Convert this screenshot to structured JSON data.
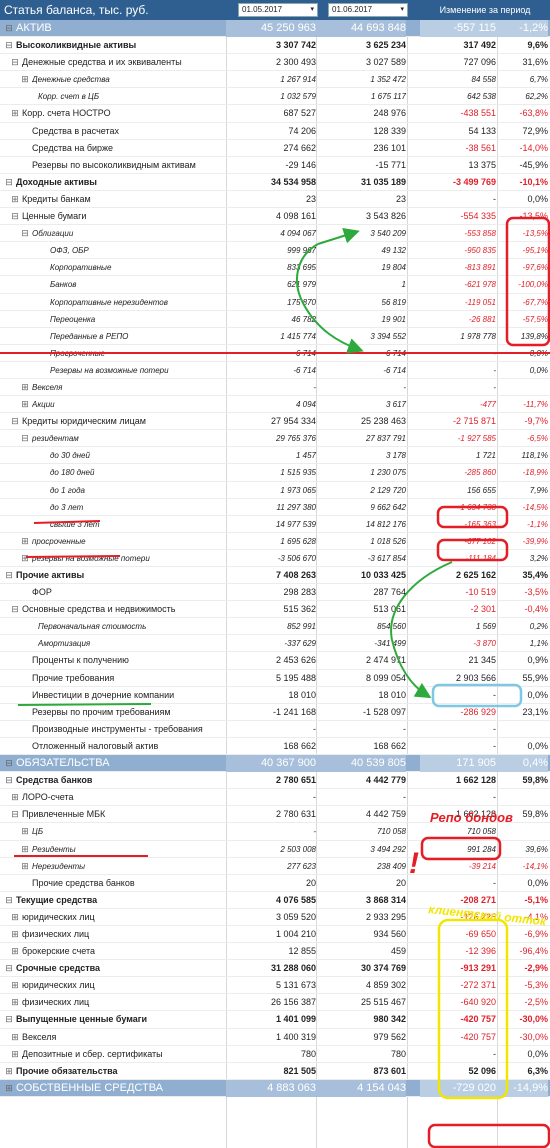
{
  "header": {
    "title": "Статья баланса, тыс. руб.",
    "date1": "01.05.2017",
    "date2": "01.06.2017",
    "dropdown_glyph": "▾",
    "change_label": "Изменение за период"
  },
  "rows": [
    {
      "exp": "⊟",
      "label": "АКТИВ",
      "v1": "45 250 963",
      "v2": "44 693 848",
      "ch": "-557 115",
      "pc": "-1,2%",
      "ind": 4,
      "type": "section",
      "ch_neg": true,
      "pc_neg": true
    },
    {
      "exp": "⊟",
      "label": "Высоколиквидные активы",
      "v1": "3 307 742",
      "v2": "3 625 234",
      "ch": "317 492",
      "pc": "9,6%",
      "ind": 4,
      "type": "lvl0",
      "ch_neg": false,
      "pc_neg": false
    },
    {
      "exp": "⊟",
      "label": "Денежные средства и их эквиваленты",
      "v1": "2 300 493",
      "v2": "3 027 589",
      "ch": "727 096",
      "pc": "31,6%",
      "ind": 10,
      "type": "lvl1",
      "ch_neg": false,
      "pc_neg": false
    },
    {
      "exp": "⊞",
      "label": "Денежные средства",
      "v1": "1 267 914",
      "v2": "1 352 472",
      "ch": "84 558",
      "pc": "6,7%",
      "ind": 20,
      "type": "lvl2",
      "ch_neg": false,
      "pc_neg": false
    },
    {
      "exp": "",
      "label": "Корр. счет в ЦБ",
      "v1": "1 032 579",
      "v2": "1 675 117",
      "ch": "642 538",
      "pc": "62,2%",
      "ind": 26,
      "type": "lvl2",
      "ch_neg": false,
      "pc_neg": false
    },
    {
      "exp": "⊞",
      "label": "Корр. счета НОСТРО",
      "v1": "687 527",
      "v2": "248 976",
      "ch": "-438 551",
      "pc": "-63,8%",
      "ind": 10,
      "type": "lvl1",
      "ch_neg": true,
      "pc_neg": true
    },
    {
      "exp": "",
      "label": "Средства в расчетах",
      "v1": "74 206",
      "v2": "128 339",
      "ch": "54 133",
      "pc": "72,9%",
      "ind": 20,
      "type": "lvl1",
      "ch_neg": false,
      "pc_neg": false
    },
    {
      "exp": "",
      "label": "Средства на бирже",
      "v1": "274 662",
      "v2": "236 101",
      "ch": "-38 561",
      "pc": "-14,0%",
      "ind": 20,
      "type": "lvl1",
      "ch_neg": true,
      "pc_neg": true
    },
    {
      "exp": "",
      "label": "Резервы по высоколиквидным активам",
      "v1": "-29 146",
      "v2": "-15 771",
      "ch": "13 375",
      "pc": "-45,9%",
      "ind": 20,
      "type": "lvl1",
      "ch_neg": false,
      "pc_neg": false
    },
    {
      "exp": "⊟",
      "label": "Доходные активы",
      "v1": "34 534 958",
      "v2": "31 035 189",
      "ch": "-3 499 769",
      "pc": "-10,1%",
      "ind": 4,
      "type": "lvl0",
      "ch_neg": true,
      "pc_neg": true
    },
    {
      "exp": "⊞",
      "label": "Кредиты банкам",
      "v1": "23",
      "v2": "23",
      "ch": "-",
      "pc": "0,0%",
      "ind": 10,
      "type": "lvl1",
      "ch_neg": false,
      "pc_neg": false
    },
    {
      "exp": "⊟",
      "label": "Ценные бумаги",
      "v1": "4 098 161",
      "v2": "3 543 826",
      "ch": "-554 335",
      "pc": "-13,5%",
      "ind": 10,
      "type": "lvl1",
      "ch_neg": true,
      "pc_neg": true
    },
    {
      "exp": "⊟",
      "label": "Облигации",
      "v1": "4 094 067",
      "v2": "3 540 209",
      "ch": "-553 858",
      "pc": "-13,5%",
      "ind": 20,
      "type": "lvl2",
      "ch_neg": true,
      "pc_neg": true
    },
    {
      "exp": "",
      "label": "ОФЗ, ОБР",
      "v1": "999 967",
      "v2": "49 132",
      "ch": "-950 835",
      "pc": "-95,1%",
      "ind": 38,
      "type": "lvl3",
      "ch_neg": true,
      "pc_neg": true
    },
    {
      "exp": "",
      "label": "Корпоративные",
      "v1": "833 695",
      "v2": "19 804",
      "ch": "-813 891",
      "pc": "-97,6%",
      "ind": 38,
      "type": "lvl3",
      "ch_neg": true,
      "pc_neg": true
    },
    {
      "exp": "",
      "label": "Банков",
      "v1": "621 979",
      "v2": "1",
      "ch": "-621 978",
      "pc": "-100,0%",
      "ind": 38,
      "type": "lvl3",
      "ch_neg": true,
      "pc_neg": true
    },
    {
      "exp": "",
      "label": "Корпоративные нерезидентов",
      "v1": "175 870",
      "v2": "56 819",
      "ch": "-119 051",
      "pc": "-67,7%",
      "ind": 38,
      "type": "lvl3",
      "ch_neg": true,
      "pc_neg": true
    },
    {
      "exp": "",
      "label": "Переоценка",
      "v1": "46 782",
      "v2": "19 901",
      "ch": "-26 881",
      "pc": "-57,5%",
      "ind": 38,
      "type": "lvl3",
      "ch_neg": true,
      "pc_neg": true
    },
    {
      "exp": "",
      "label": "Переданные в РЕПО",
      "v1": "1 415 774",
      "v2": "3 394 552",
      "ch": "1 978 778",
      "pc": "139,8%",
      "ind": 38,
      "type": "lvl3",
      "ch_neg": false,
      "pc_neg": false
    },
    {
      "exp": "",
      "label": "Просроченные",
      "v1": "6 714",
      "v2": "6 714",
      "ch": "-",
      "pc": "0,0%",
      "ind": 38,
      "type": "lvl3",
      "ch_neg": false,
      "pc_neg": false
    },
    {
      "exp": "",
      "label": "Резервы на возможные потери",
      "v1": "-6 714",
      "v2": "-6 714",
      "ch": "-",
      "pc": "0,0%",
      "ind": 38,
      "type": "lvl3",
      "ch_neg": false,
      "pc_neg": false
    },
    {
      "exp": "⊞",
      "label": "Векселя",
      "v1": "-",
      "v2": "-",
      "ch": "-",
      "pc": "",
      "ind": 20,
      "type": "lvl2",
      "ch_neg": false,
      "pc_neg": false
    },
    {
      "exp": "⊞",
      "label": "Акции",
      "v1": "4 094",
      "v2": "3 617",
      "ch": "-477",
      "pc": "-11,7%",
      "ind": 20,
      "type": "lvl2",
      "ch_neg": true,
      "pc_neg": true
    },
    {
      "exp": "⊟",
      "label": "Кредиты юридическим лицам",
      "v1": "27 954 334",
      "v2": "25 238 463",
      "ch": "-2 715 871",
      "pc": "-9,7%",
      "ind": 10,
      "type": "lvl1",
      "ch_neg": true,
      "pc_neg": true
    },
    {
      "exp": "⊟",
      "label": "резидентам",
      "v1": "29 765 376",
      "v2": "27 837 791",
      "ch": "-1 927 585",
      "pc": "-6,5%",
      "ind": 20,
      "type": "lvl2",
      "ch_neg": true,
      "pc_neg": true
    },
    {
      "exp": "",
      "label": "до 30 дней",
      "v1": "1 457",
      "v2": "3 178",
      "ch": "1 721",
      "pc": "118,1%",
      "ind": 38,
      "type": "lvl3",
      "ch_neg": false,
      "pc_neg": false
    },
    {
      "exp": "",
      "label": "до 180 дней",
      "v1": "1 515 935",
      "v2": "1 230 075",
      "ch": "-285 860",
      "pc": "-18,9%",
      "ind": 38,
      "type": "lvl3",
      "ch_neg": true,
      "pc_neg": true
    },
    {
      "exp": "",
      "label": "до 1 года",
      "v1": "1 973 065",
      "v2": "2 129 720",
      "ch": "156 655",
      "pc": "7,9%",
      "ind": 38,
      "type": "lvl3",
      "ch_neg": false,
      "pc_neg": false
    },
    {
      "exp": "",
      "label": "до 3 лет",
      "v1": "11 297 380",
      "v2": "9 662 642",
      "ch": "-1 634 738",
      "pc": "-14,5%",
      "ind": 38,
      "type": "lvl3",
      "ch_neg": true,
      "pc_neg": true
    },
    {
      "exp": "",
      "label": "свыше 3 лет",
      "v1": "14 977 539",
      "v2": "14 812 176",
      "ch": "-165 363",
      "pc": "-1,1%",
      "ind": 38,
      "type": "lvl3",
      "ch_neg": true,
      "pc_neg": true
    },
    {
      "exp": "⊞",
      "label": "просроченные",
      "v1": "1 695 628",
      "v2": "1 018 526",
      "ch": "-677 102",
      "pc": "-39,9%",
      "ind": 20,
      "type": "lvl2",
      "ch_neg": true,
      "pc_neg": true
    },
    {
      "exp": "⊞",
      "label": "резервы на возможные потери",
      "v1": "-3 506 670",
      "v2": "-3 617 854",
      "ch": "-111 184",
      "pc": "3,2%",
      "ind": 20,
      "type": "lvl2",
      "ch_neg": true,
      "pc_neg": false
    },
    {
      "exp": "⊟",
      "label": "Прочие активы",
      "v1": "7 408 263",
      "v2": "10 033 425",
      "ch": "2 625 162",
      "pc": "35,4%",
      "ind": 4,
      "type": "lvl0",
      "ch_neg": false,
      "pc_neg": false
    },
    {
      "exp": "",
      "label": "ФОР",
      "v1": "298 283",
      "v2": "287 764",
      "ch": "-10 519",
      "pc": "-3,5%",
      "ind": 20,
      "type": "lvl1",
      "ch_neg": true,
      "pc_neg": true
    },
    {
      "exp": "⊟",
      "label": "Основные средства и недвижимость",
      "v1": "515 362",
      "v2": "513 061",
      "ch": "-2 301",
      "pc": "-0,4%",
      "ind": 10,
      "type": "lvl1",
      "ch_neg": true,
      "pc_neg": true
    },
    {
      "exp": "",
      "label": "Первоначальная стоимость",
      "v1": "852 991",
      "v2": "854 560",
      "ch": "1 569",
      "pc": "0,2%",
      "ind": 26,
      "type": "lvl2",
      "ch_neg": false,
      "pc_neg": false
    },
    {
      "exp": "",
      "label": "Амортизация",
      "v1": "-337 629",
      "v2": "-341 499",
      "ch": "-3 870",
      "pc": "1,1%",
      "ind": 26,
      "type": "lvl2",
      "ch_neg": true,
      "pc_neg": false
    },
    {
      "exp": "",
      "label": "Проценты к получению",
      "v1": "2 453 626",
      "v2": "2 474 971",
      "ch": "21 345",
      "pc": "0,9%",
      "ind": 20,
      "type": "lvl1",
      "ch_neg": false,
      "pc_neg": false
    },
    {
      "exp": "",
      "label": "Прочие требования",
      "v1": "5 195 488",
      "v2": "8 099 054",
      "ch": "2 903 566",
      "pc": "55,9%",
      "ind": 20,
      "type": "lvl1",
      "ch_neg": false,
      "pc_neg": false
    },
    {
      "exp": "",
      "label": "Инвестиции в дочерние компании",
      "v1": "18 010",
      "v2": "18 010",
      "ch": "-",
      "pc": "0,0%",
      "ind": 20,
      "type": "lvl1",
      "ch_neg": false,
      "pc_neg": false
    },
    {
      "exp": "",
      "label": "Резервы по прочим требованиям",
      "v1": "-1 241 168",
      "v2": "-1 528 097",
      "ch": "-286 929",
      "pc": "23,1%",
      "ind": 20,
      "type": "lvl1",
      "ch_neg": true,
      "pc_neg": false
    },
    {
      "exp": "",
      "label": "Производные инструменты - требования",
      "v1": "-",
      "v2": "-",
      "ch": "-",
      "pc": "",
      "ind": 20,
      "type": "lvl1",
      "ch_neg": false,
      "pc_neg": false
    },
    {
      "exp": "",
      "label": "Отложенный налоговый актив",
      "v1": "168 662",
      "v2": "168 662",
      "ch": "-",
      "pc": "0,0%",
      "ind": 20,
      "type": "lvl1",
      "ch_neg": false,
      "pc_neg": false
    },
    {
      "exp": "⊟",
      "label": "ОБЯЗАТЕЛЬСТВА",
      "v1": "40 367 900",
      "v2": "40 539 805",
      "ch": "171 905",
      "pc": "0,4%",
      "ind": 4,
      "type": "section",
      "ch_neg": false,
      "pc_neg": false
    },
    {
      "exp": "⊟",
      "label": "Средства банков",
      "v1": "2 780 651",
      "v2": "4 442 779",
      "ch": "1 662 128",
      "pc": "59,8%",
      "ind": 4,
      "type": "lvl0",
      "ch_neg": false,
      "pc_neg": false
    },
    {
      "exp": "⊞",
      "label": "ЛОРО-счета",
      "v1": "-",
      "v2": "-",
      "ch": "-",
      "pc": "",
      "ind": 10,
      "type": "lvl1",
      "ch_neg": false,
      "pc_neg": false
    },
    {
      "exp": "⊟",
      "label": "Привлеченные МБК",
      "v1": "2 780 631",
      "v2": "4 442 759",
      "ch": "1 662 128",
      "pc": "59,8%",
      "ind": 10,
      "type": "lvl1",
      "ch_neg": false,
      "pc_neg": false
    },
    {
      "exp": "⊞",
      "label": "ЦБ",
      "v1": "-",
      "v2": "710 058",
      "ch": "710 058",
      "pc": "",
      "ind": 20,
      "type": "lvl2",
      "ch_neg": false,
      "pc_neg": false
    },
    {
      "exp": "⊞",
      "label": "Резиденты",
      "v1": "2 503 008",
      "v2": "3 494 292",
      "ch": "991 284",
      "pc": "39,6%",
      "ind": 20,
      "type": "lvl2",
      "ch_neg": false,
      "pc_neg": false
    },
    {
      "exp": "⊞",
      "label": "Нерезиденты",
      "v1": "277 623",
      "v2": "238 409",
      "ch": "-39 214",
      "pc": "-14,1%",
      "ind": 20,
      "type": "lvl2",
      "ch_neg": true,
      "pc_neg": true
    },
    {
      "exp": "",
      "label": "Прочие средства банков",
      "v1": "20",
      "v2": "20",
      "ch": "-",
      "pc": "0,0%",
      "ind": 20,
      "type": "lvl1",
      "ch_neg": false,
      "pc_neg": false
    },
    {
      "exp": "⊟",
      "label": "Текущие средства",
      "v1": "4 076 585",
      "v2": "3 868 314",
      "ch": "-208 271",
      "pc": "-5,1%",
      "ind": 4,
      "type": "lvl0",
      "ch_neg": true,
      "pc_neg": true
    },
    {
      "exp": "⊞",
      "label": "юридических лиц",
      "v1": "3 059 520",
      "v2": "2 933 295",
      "ch": "-126 225",
      "pc": "-4,1%",
      "ind": 10,
      "type": "lvl1",
      "ch_neg": true,
      "pc_neg": true
    },
    {
      "exp": "⊞",
      "label": "физических лиц",
      "v1": "1 004 210",
      "v2": "934 560",
      "ch": "-69 650",
      "pc": "-6,9%",
      "ind": 10,
      "type": "lvl1",
      "ch_neg": true,
      "pc_neg": true
    },
    {
      "exp": "⊞",
      "label": "брокерские счета",
      "v1": "12 855",
      "v2": "459",
      "ch": "-12 396",
      "pc": "-96,4%",
      "ind": 10,
      "type": "lvl1",
      "ch_neg": true,
      "pc_neg": true
    },
    {
      "exp": "⊟",
      "label": "Срочные средства",
      "v1": "31 288 060",
      "v2": "30 374 769",
      "ch": "-913 291",
      "pc": "-2,9%",
      "ind": 4,
      "type": "lvl0",
      "ch_neg": true,
      "pc_neg": true
    },
    {
      "exp": "⊞",
      "label": "юридических лиц",
      "v1": "5 131 673",
      "v2": "4 859 302",
      "ch": "-272 371",
      "pc": "-5,3%",
      "ind": 10,
      "type": "lvl1",
      "ch_neg": true,
      "pc_neg": true
    },
    {
      "exp": "⊞",
      "label": "физических лиц",
      "v1": "26 156 387",
      "v2": "25 515 467",
      "ch": "-640 920",
      "pc": "-2,5%",
      "ind": 10,
      "type": "lvl1",
      "ch_neg": true,
      "pc_neg": true
    },
    {
      "exp": "⊟",
      "label": "Выпущенные ценные бумаги",
      "v1": "1 401 099",
      "v2": "980 342",
      "ch": "-420 757",
      "pc": "-30,0%",
      "ind": 4,
      "type": "lvl0",
      "ch_neg": true,
      "pc_neg": true
    },
    {
      "exp": "⊞",
      "label": "Векселя",
      "v1": "1 400 319",
      "v2": "979 562",
      "ch": "-420 757",
      "pc": "-30,0%",
      "ind": 10,
      "type": "lvl1",
      "ch_neg": true,
      "pc_neg": true
    },
    {
      "exp": "⊞",
      "label": "Депозитные и сбер. сертификаты",
      "v1": "780",
      "v2": "780",
      "ch": "-",
      "pc": "0,0%",
      "ind": 10,
      "type": "lvl1",
      "ch_neg": false,
      "pc_neg": false
    },
    {
      "exp": "⊞",
      "label": "Прочие обязательства",
      "v1": "821 505",
      "v2": "873 601",
      "ch": "52 096",
      "pc": "6,3%",
      "ind": 4,
      "type": "lvl0",
      "ch_neg": false,
      "pc_neg": false
    },
    {
      "exp": "⊞",
      "label": "СОБСТВЕННЫЕ СРЕДСТВА",
      "v1": "4 883 063",
      "v2": "4 154 043",
      "ch": "-729 020",
      "pc": "-14,9%",
      "ind": 4,
      "type": "section",
      "ch_neg": true,
      "pc_neg": true
    }
  ],
  "annotations": {
    "repo_note": "Репо бондов",
    "exclaim": "!",
    "client_outflow_note": "клиентский отток",
    "colors": {
      "red": "#e41e26",
      "green": "#2eaa3c",
      "cyan": "#7ec8e3",
      "yellow": "#f2e600",
      "accent": "#2f5f90",
      "section_bg": "#8faed0"
    }
  }
}
